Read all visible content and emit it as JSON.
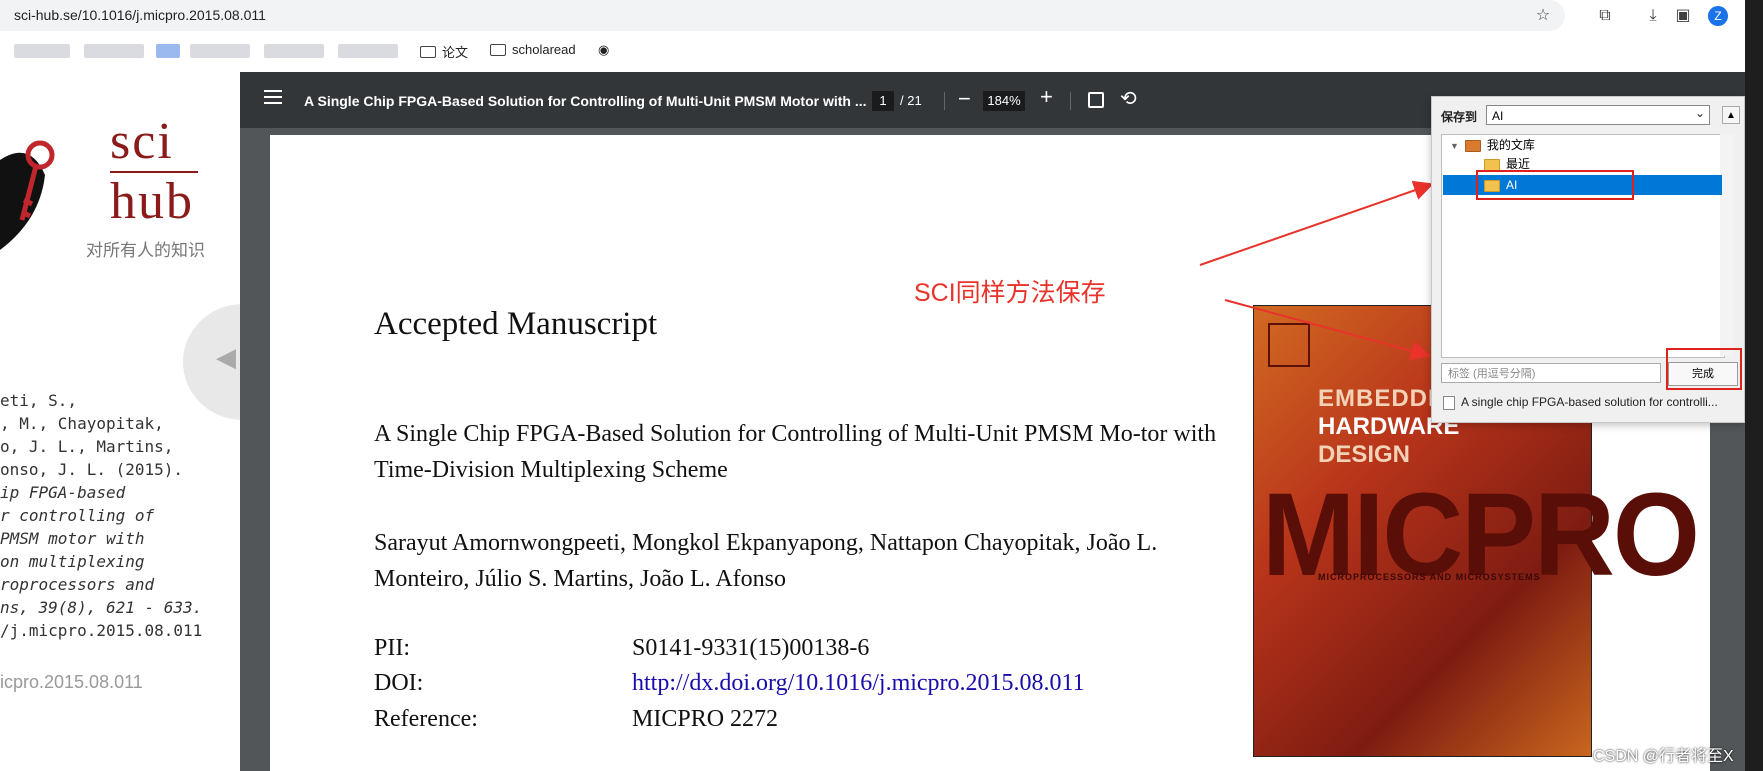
{
  "browser": {
    "url": "sci-hub.se/10.1016/j.micpro.2015.08.011",
    "avatar_letter": "Z",
    "bookmarks": [
      {
        "label": "论文",
        "icon": "folder-icon"
      },
      {
        "label": "scholaread",
        "icon": "folder-icon"
      }
    ]
  },
  "scihub": {
    "logo_top": "sci",
    "logo_bottom": "hub",
    "tagline": "对所有人的知识",
    "citation_lines": [
      "eti, S.,",
      ", M., Chayopitak,",
      "o, J. L., Martins,",
      "onso, J. L. (2015).",
      "ip FPGA-based",
      "r controlling of",
      "PMSM motor with",
      "on multiplexing",
      "roprocessors and",
      "ns, 39(8), 621 - 633.",
      "/j.micpro.2015.08.011"
    ],
    "doi": "icpro.2015.08.011"
  },
  "pdf_toolbar": {
    "title": "A Single Chip FPGA-Based Solution for Controlling of Multi-Unit PMSM Motor with ...",
    "page_current": "1",
    "page_total": "/ 21",
    "zoom": "184%"
  },
  "pdf_page": {
    "heading": "Accepted Manuscript",
    "paper_title": "A Single Chip FPGA-Based Solution for Controlling of Multi-Unit PMSM Mo-tor with Time-Division Multiplexing Scheme",
    "authors": "Sarayut Amornwongpeeti, Mongkol Ekpanyapong, Nattapon Chayopitak, João L. Monteiro, Júlio S. Martins, João L. Afonso",
    "meta": [
      {
        "key": "PII:",
        "value": "S0141-9331(15)00138-6"
      },
      {
        "key": "DOI:",
        "value": "http://dx.doi.org/10.1016/j.micpro.2015.08.011"
      },
      {
        "key": "Reference:",
        "value": "MICPRO 2272"
      }
    ],
    "cover": {
      "line1": "EMBEDDED",
      "line2": "HARDWARE",
      "line3": "DESIGN",
      "big": "MICPRO",
      "sub": "MICROPROCESSORS AND MICROSYSTEMS"
    }
  },
  "annotation": {
    "text": "SCI同样方法保存",
    "color": "#e8322a"
  },
  "save_dialog": {
    "label": "保存到",
    "selected": "AI",
    "tree": [
      {
        "label": "我的文库"
      },
      {
        "label": "最近"
      },
      {
        "label": "AI"
      }
    ],
    "tag_placeholder": "标签 (用逗号分隔)",
    "done_label": "完成",
    "file_label": "A single chip FPGA-based solution for controlli..."
  },
  "watermark": "CSDN @行者将至X"
}
